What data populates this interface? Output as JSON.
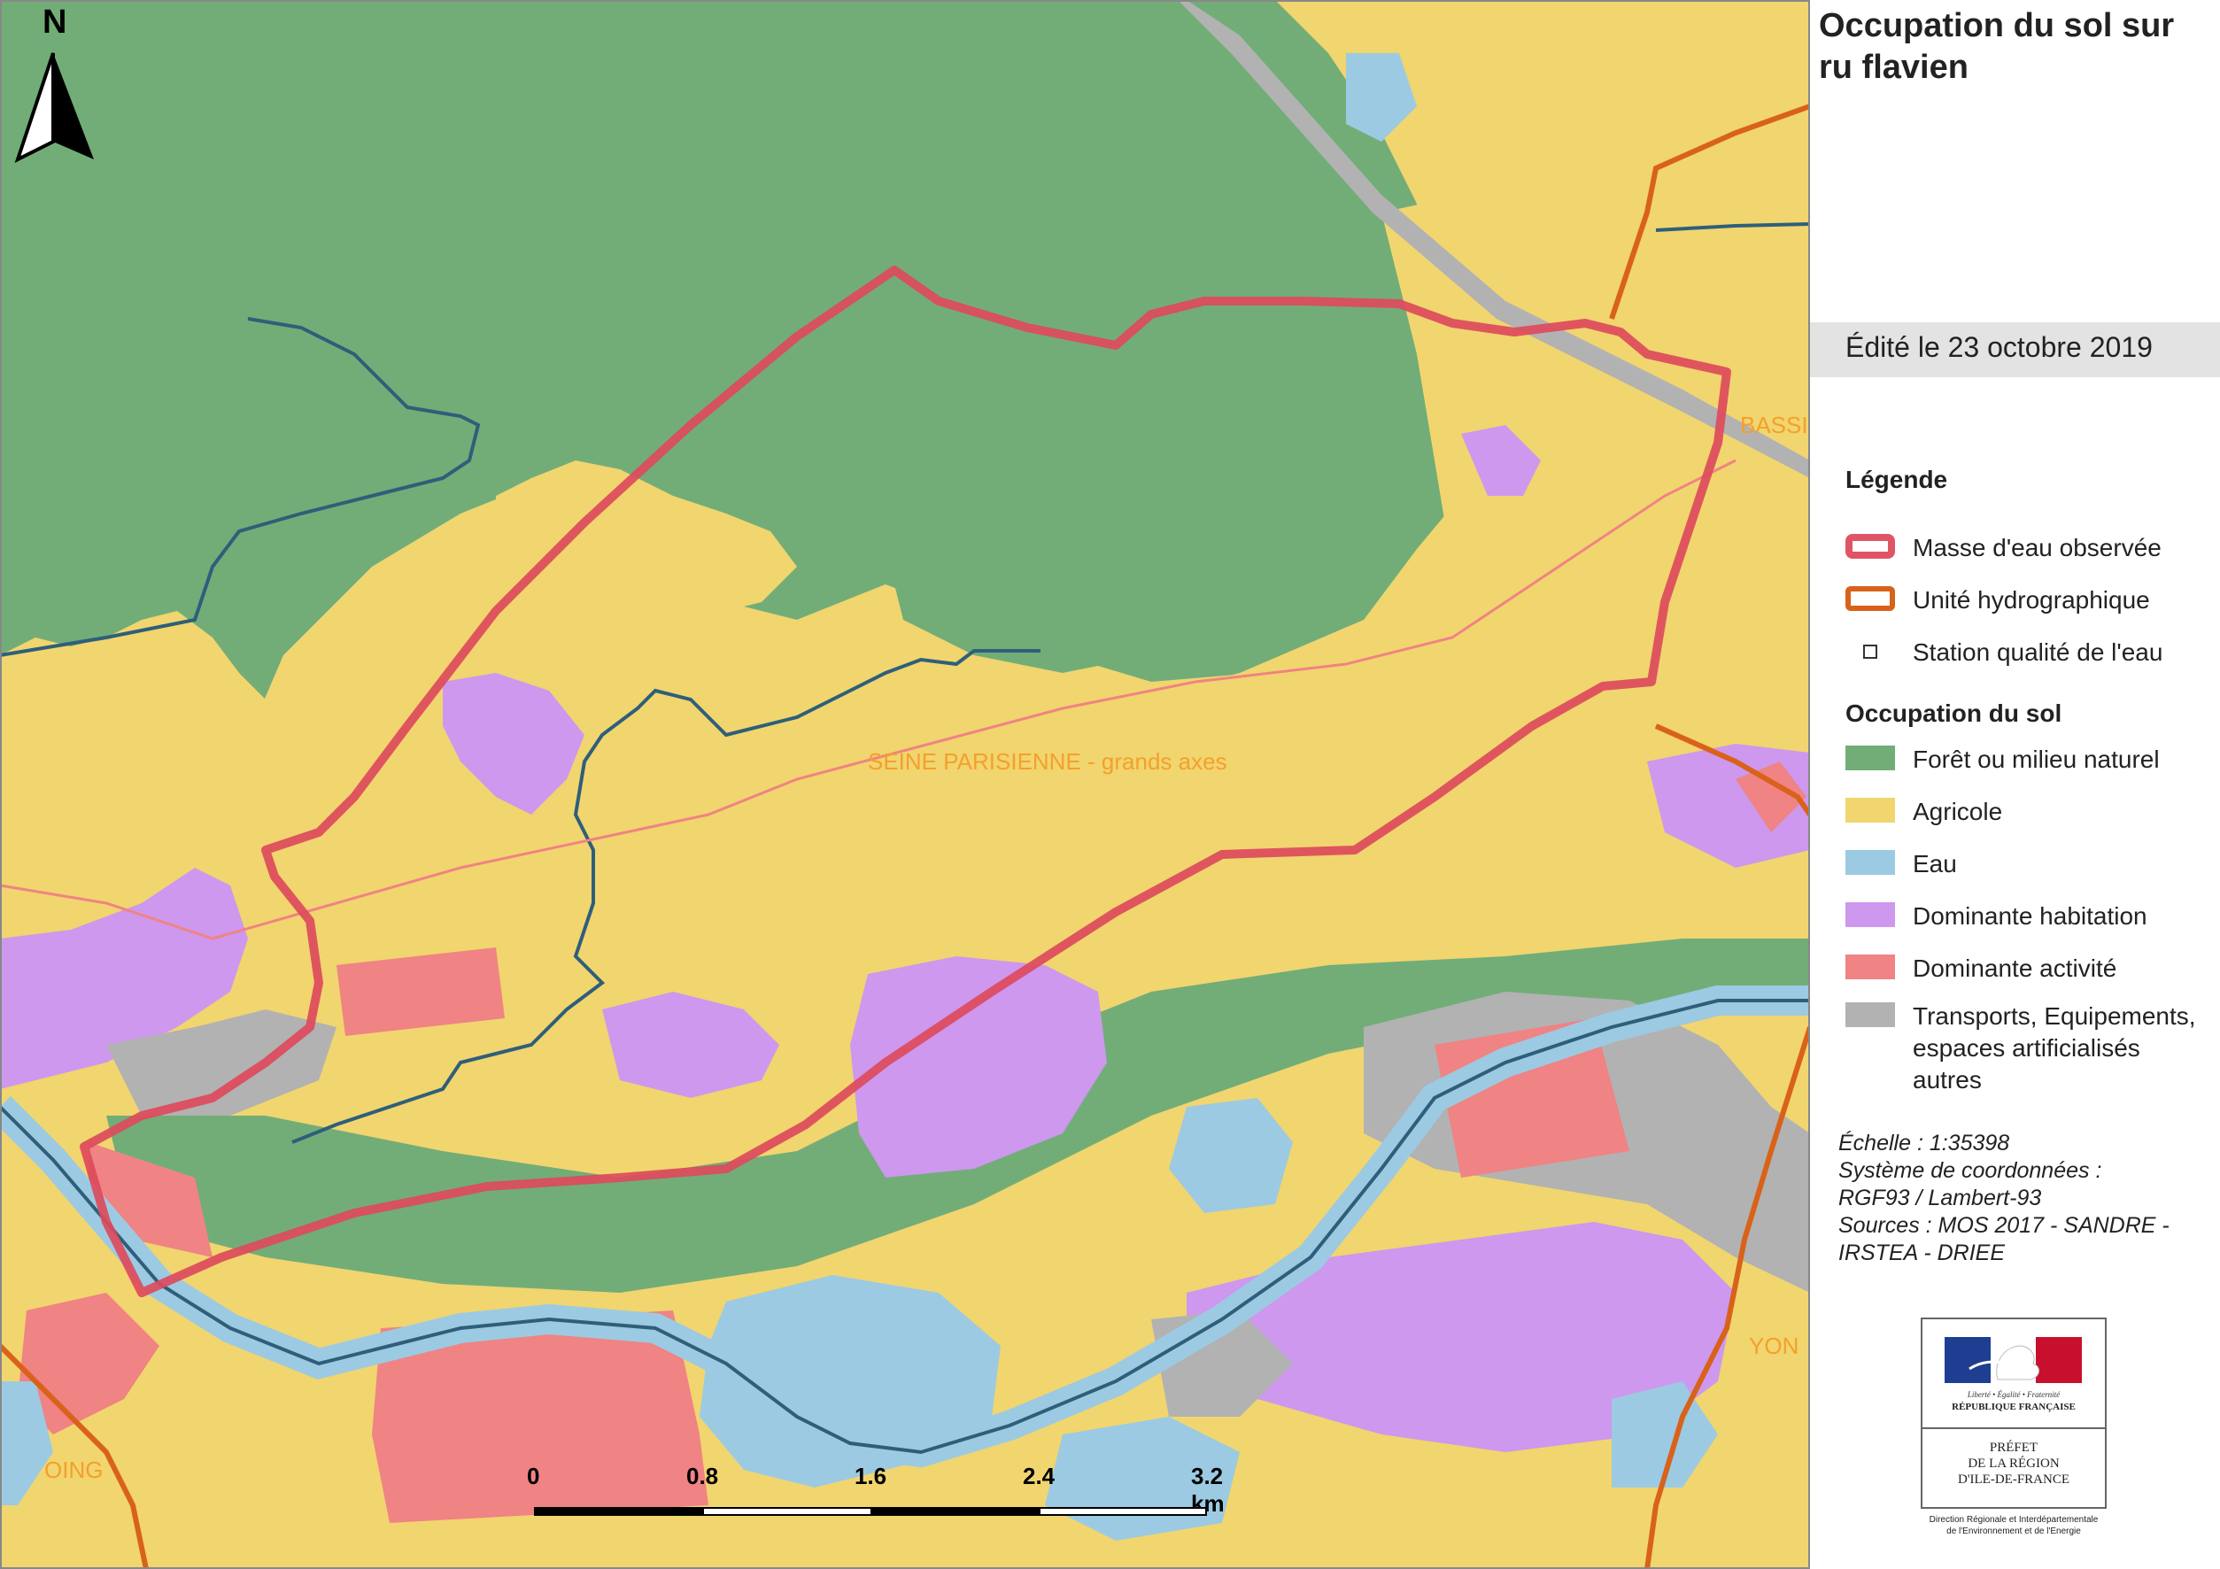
{
  "map": {
    "north_label": "N",
    "labels": {
      "seine": "SEINE PARISIENNE - grands axes",
      "right_top": "BASSI",
      "right_bottom": "YON",
      "left_bottom": "OING"
    },
    "scale": {
      "ticks": [
        "0",
        "0.8",
        "1.6",
        "2.4",
        "3.2  km"
      ]
    }
  },
  "panel": {
    "title": "Occupation du sol sur ru flavien",
    "edited": "Édité le 23 octobre 2019",
    "legend": {
      "heading": "Légende",
      "items": [
        {
          "label": "Masse d'eau observée",
          "color": "#e05565",
          "style": "outline"
        },
        {
          "label": "Unité hydrographique",
          "color": "#d9621a",
          "style": "outline"
        },
        {
          "label": "Station qualité de l'eau",
          "color": "#333333",
          "style": "square"
        }
      ]
    },
    "landuse": {
      "heading": "Occupation du sol",
      "items": [
        {
          "label": "Forêt ou milieu naturel",
          "color": "#72ad78"
        },
        {
          "label": "Agricole",
          "color": "#f1d56f"
        },
        {
          "label": "Eau",
          "color": "#9ccae2"
        },
        {
          "label": "Dominante habitation",
          "color": "#cd98ee"
        },
        {
          "label": "Dominante activité",
          "color": "#f08383"
        },
        {
          "label": "Transports, Equipements, espaces artificialisés\n autres",
          "color": "#b2b2b2"
        }
      ]
    },
    "meta": {
      "scale": "Échelle :  1:35398",
      "crs_1": "Système de coordonnées :",
      "crs_2": "RGF93 / Lambert-93",
      "sources_1": "Sources : MOS 2017 - SANDRE -",
      "sources_2": "IRSTEA - DRIEE"
    },
    "logo": {
      "motto": "Liberté • Égalité • Fraternité",
      "republic": "RÉPUBLIQUE FRANÇAISE",
      "prefect": "PRÉFET\nDE LA RÉGION\nD'ILE-DE-FRANCE",
      "directorate": "Direction Régionale et Interdépartementale\nde l'Environnement et de l'Energie"
    }
  }
}
